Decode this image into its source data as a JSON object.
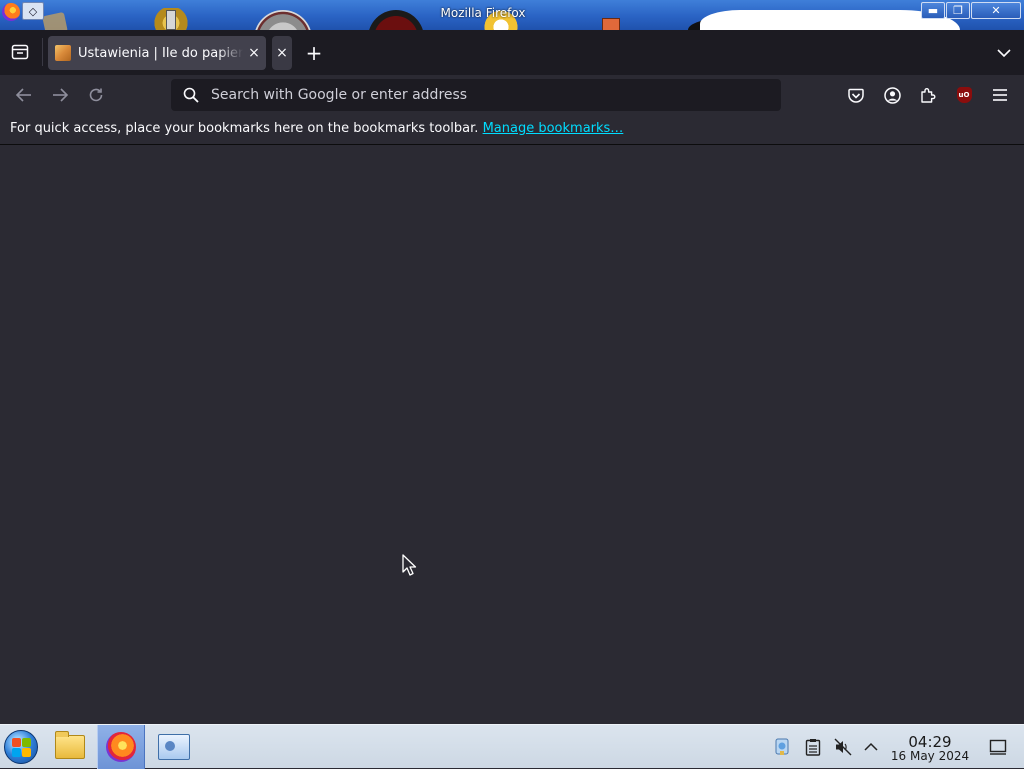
{
  "window": {
    "title": "Mozilla Firefox",
    "minimize_glyph": "▬",
    "maximize_glyph": "❐",
    "close_glyph": "✕"
  },
  "tabs": [
    {
      "title": "Ustawienia | Ile do papieru",
      "close_glyph": "×"
    }
  ],
  "tabbar": {
    "extra_close_glyph": "×",
    "new_tab_glyph": "+"
  },
  "navbar": {
    "search_placeholder": "Search with Google or enter address",
    "ublock_badge": "uO"
  },
  "bookmarks_toolbar": {
    "message": "For quick access, place your bookmarks here on the bookmarks toolbar.",
    "link_label": "Manage bookmarks…"
  },
  "taskbar": {
    "time": "04:29",
    "date": "16 May 2024"
  },
  "colors": {
    "chrome_dark": "#1c1b22",
    "toolbar": "#2b2a33",
    "tab_selected": "#42414d",
    "link": "#00ddff",
    "text": "#fbfbfe"
  },
  "icons": [
    "firefox-app-icon",
    "pin-icon",
    "tab-list-icon",
    "site-favicon",
    "close-icon",
    "plus-icon",
    "chevron-down-icon",
    "back-arrow-icon",
    "forward-arrow-icon",
    "reload-icon",
    "search-icon",
    "pocket-icon",
    "account-icon",
    "extensions-icon",
    "ublock-icon",
    "hamburger-menu-icon",
    "start-orb-icon",
    "folder-icon",
    "firefox-icon",
    "remote-desktop-icon",
    "network-icon",
    "clipboard-icon",
    "speaker-muted-icon",
    "chevron-up-icon",
    "notification-icon",
    "mouse-cursor-icon"
  ]
}
